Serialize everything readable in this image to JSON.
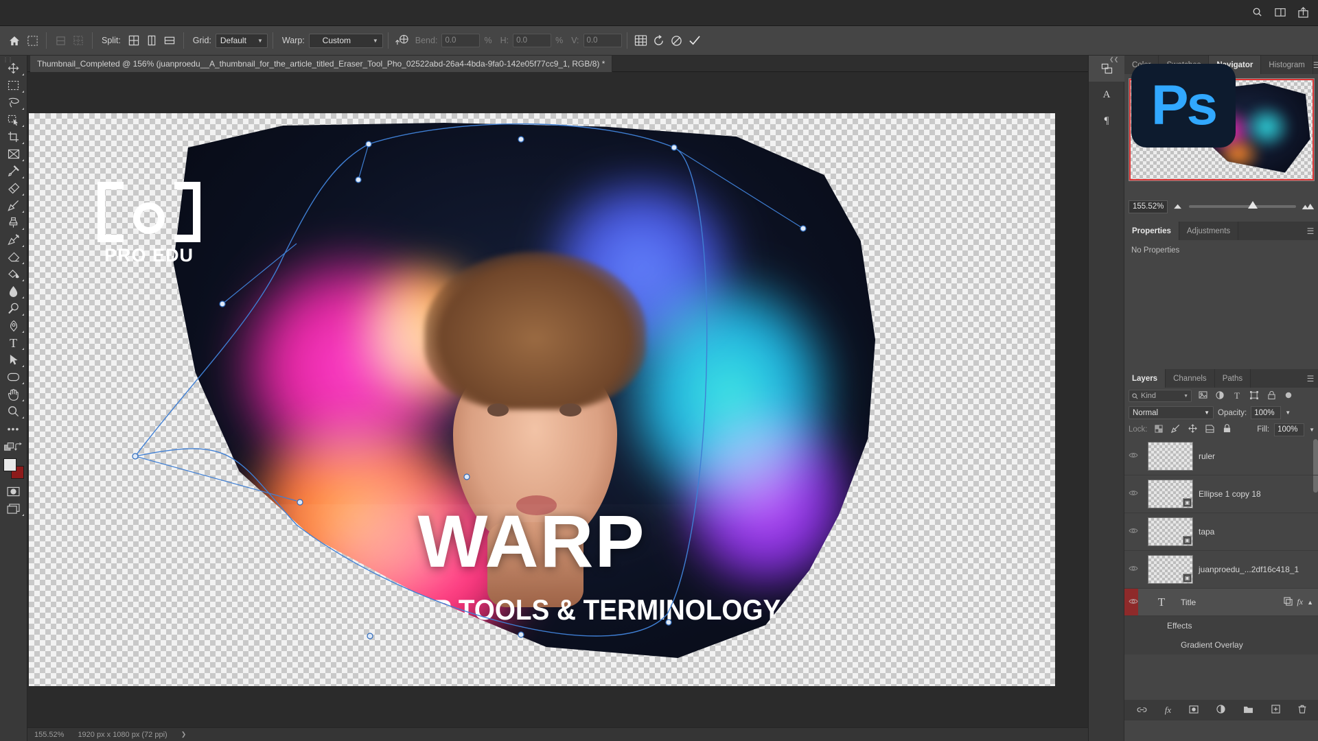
{
  "app": {
    "name": "Adobe Photoshop",
    "logo_text": "Ps",
    "logo_bg": "#0d1b2e",
    "logo_fg": "#31a8ff"
  },
  "options_bar": {
    "home_icon": "home-icon",
    "transform_icon": "free-transform-icon",
    "split_label": "Split:",
    "split_icons": [
      "split-grid-icon",
      "split-vertical-icon",
      "split-horizontal-icon"
    ],
    "grid_label": "Grid:",
    "grid_value": "Default",
    "warp_label": "Warp:",
    "warp_value": "Custom",
    "warp_split_icon": "warp-split-icon",
    "bend_label": "Bend:",
    "bend_value": "0.0",
    "bend_unit": "%",
    "h_label": "H:",
    "h_value": "0.0",
    "h_unit": "%",
    "v_label": "V:",
    "v_value": "0.0",
    "mesh_icon": "mesh-icon",
    "reset_icon": "reset-icon",
    "cancel_icon": "cancel-icon",
    "commit_icon": "commit-check-icon"
  },
  "appbar_right": {
    "search_icon": "search-icon",
    "arrange_icon": "arrange-documents-icon",
    "share_icon": "share-icon"
  },
  "document": {
    "tab_title": "Thumbnail_Completed @ 156% (juanproedu__A_thumbnail_for_the_article_titled_Eraser_Tool_Pho_02522abd-26a4-4bda-9fa0-142e05f77cc9_1, RGB/8) *"
  },
  "toolbar": {
    "items": [
      {
        "name": "move-tool",
        "glyph": "move"
      },
      {
        "name": "rectangular-select-tool",
        "glyph": "marquee"
      },
      {
        "name": "lasso-tool",
        "glyph": "lasso"
      },
      {
        "name": "object-selection-tool",
        "glyph": "objsel"
      },
      {
        "name": "crop-tool",
        "glyph": "crop"
      },
      {
        "name": "frame-tool",
        "glyph": "frame"
      },
      {
        "name": "eyedropper-tool",
        "glyph": "eyedropper"
      },
      {
        "name": "spot-healing-brush-tool",
        "glyph": "heal"
      },
      {
        "name": "brush-tool",
        "glyph": "brush"
      },
      {
        "name": "clone-stamp-tool",
        "glyph": "stamp"
      },
      {
        "name": "history-brush-tool",
        "glyph": "historybrush"
      },
      {
        "name": "eraser-tool",
        "glyph": "eraser"
      },
      {
        "name": "gradient-tool",
        "glyph": "gradient"
      },
      {
        "name": "blur-tool",
        "glyph": "blur"
      },
      {
        "name": "dodge-tool",
        "glyph": "dodge"
      },
      {
        "name": "pen-tool",
        "glyph": "pen"
      },
      {
        "name": "type-tool",
        "glyph": "type"
      },
      {
        "name": "path-selection-tool",
        "glyph": "pathsel"
      },
      {
        "name": "rectangle-tool",
        "glyph": "rect"
      },
      {
        "name": "hand-tool",
        "glyph": "hand"
      },
      {
        "name": "zoom-tool",
        "glyph": "zoom"
      },
      {
        "name": "edit-toolbar-button",
        "glyph": "dots"
      }
    ],
    "quickmask_icon": "quick-mask-icon",
    "screenmode_icon": "screen-mode-icon",
    "swap_colors_icon": "swap-colors-icon",
    "default_colors_icon": "default-colors-icon",
    "foreground_color": "#e9e9e9",
    "background_color": "#8d1b1b"
  },
  "artwork": {
    "title": "WARP",
    "subtitle": "PHOTOSHOP TOOLS & TERMINOLOGY",
    "logo_bracket_text": "PRO EDU"
  },
  "statusbar": {
    "zoom": "155.52%",
    "dimensions": "1920 px x 1080 px (72 ppi)",
    "expand_icon": "chevron-right-icon"
  },
  "dock": {
    "rail": [
      {
        "name": "rail-button-properties-stack",
        "glyph": "stack"
      },
      {
        "name": "rail-button-character",
        "glyph": "A"
      },
      {
        "name": "rail-button-paragraph",
        "glyph": "pilcrow"
      }
    ],
    "navigator": {
      "tabs": [
        {
          "label": "Color",
          "active": false
        },
        {
          "label": "Swatches",
          "active": false
        },
        {
          "label": "Navigator",
          "active": true
        },
        {
          "label": "Histogram",
          "active": false
        }
      ],
      "zoom_value": "155.52%",
      "menu_icon": "panel-menu-icon",
      "zoom_out_icon": "zoom-out-mountain-icon",
      "zoom_in_icon": "zoom-in-mountains-icon"
    },
    "properties": {
      "tabs": [
        {
          "label": "Properties",
          "active": true
        },
        {
          "label": "Adjustments",
          "active": false
        }
      ],
      "body_text": "No Properties",
      "menu_icon": "panel-menu-icon"
    },
    "layers": {
      "tabs": [
        {
          "label": "Layers",
          "active": true
        },
        {
          "label": "Channels",
          "active": false
        },
        {
          "label": "Paths",
          "active": false
        }
      ],
      "menu_icon": "panel-menu-icon",
      "filter": {
        "search_icon": "search-icon",
        "kind_label": "Kind",
        "icons": [
          "filter-pixel-icon",
          "filter-adjustment-icon",
          "filter-type-icon",
          "filter-shape-icon",
          "filter-smart-object-icon",
          "filter-toggle-icon"
        ]
      },
      "blend_mode": "Normal",
      "opacity_label": "Opacity:",
      "opacity_value": "100%",
      "lock_label": "Lock:",
      "lock_icons": [
        "lock-transparent-pixels-icon",
        "lock-image-pixels-icon",
        "lock-position-icon",
        "lock-artboard-nesting-icon",
        "lock-all-icon"
      ],
      "fill_label": "Fill:",
      "fill_value": "100%",
      "rows": [
        {
          "name": "ruler",
          "type": "pixel",
          "badge": "",
          "visible": false
        },
        {
          "name": "Ellipse 1 copy 18",
          "type": "smart",
          "badge": "smart-object-badge",
          "visible": false
        },
        {
          "name": "tapa",
          "type": "smart",
          "badge": "smart-object-badge",
          "visible": false
        },
        {
          "name": "juanproedu_...2df16c418_1",
          "type": "smart",
          "badge": "smart-object-badge",
          "visible": false
        }
      ],
      "text_layer": {
        "name": "Title",
        "type_icon": "type-layer-icon",
        "link_icon": "link-layers-icon",
        "fx_icon": "fx-icon",
        "collapse_icon": "chevron-up-icon",
        "effects_label": "Effects",
        "effect_items": [
          "Gradient Overlay"
        ]
      },
      "footer_icons": [
        "link-layers-icon",
        "fx-icon",
        "add-mask-icon",
        "new-adjustment-layer-icon",
        "new-group-icon",
        "new-layer-icon",
        "delete-layer-icon"
      ]
    }
  },
  "colors": {
    "panel_bg": "#454545",
    "dock_bg": "#393939",
    "canvas_bg": "#2b2b2b",
    "accent": "#31a8ff",
    "mesh_line": "#3f7fd4",
    "selected_layer_strip": "#8e2a2a"
  }
}
